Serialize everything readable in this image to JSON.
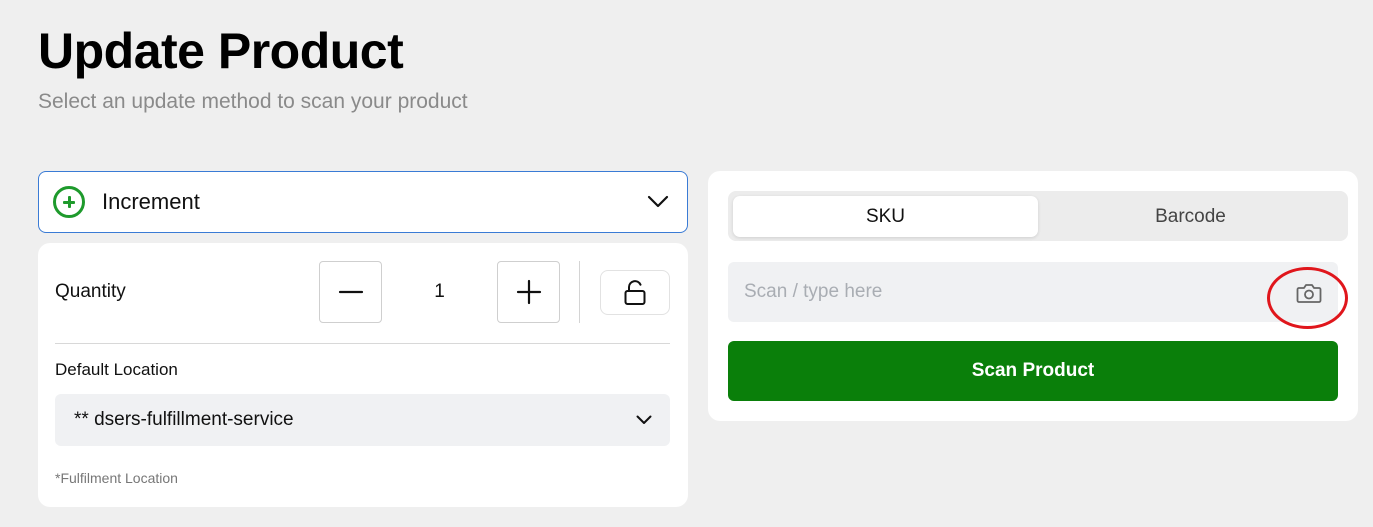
{
  "header": {
    "title": "Update Product",
    "subtitle": "Select an update method to scan your product"
  },
  "method_select": {
    "value": "Increment",
    "icon": "plus-circle-icon",
    "icon_color": "#1e9a2c"
  },
  "quantity": {
    "label": "Quantity",
    "value": "1",
    "decrement_icon": "minus-icon",
    "increment_icon": "plus-icon",
    "lock_icon": "unlock-icon"
  },
  "location": {
    "label": "Default Location",
    "value": "** dsers-fulfillment-service",
    "note": "*Fulfilment Location"
  },
  "scan": {
    "tabs": [
      {
        "label": "SKU",
        "selected": true
      },
      {
        "label": "Barcode",
        "selected": false
      }
    ],
    "input_placeholder": "Scan / type here",
    "input_value": "",
    "camera_icon": "camera-icon",
    "button_label": "Scan Product",
    "button_color": "#0a7f0a",
    "highlight_color": "#e0161c"
  }
}
